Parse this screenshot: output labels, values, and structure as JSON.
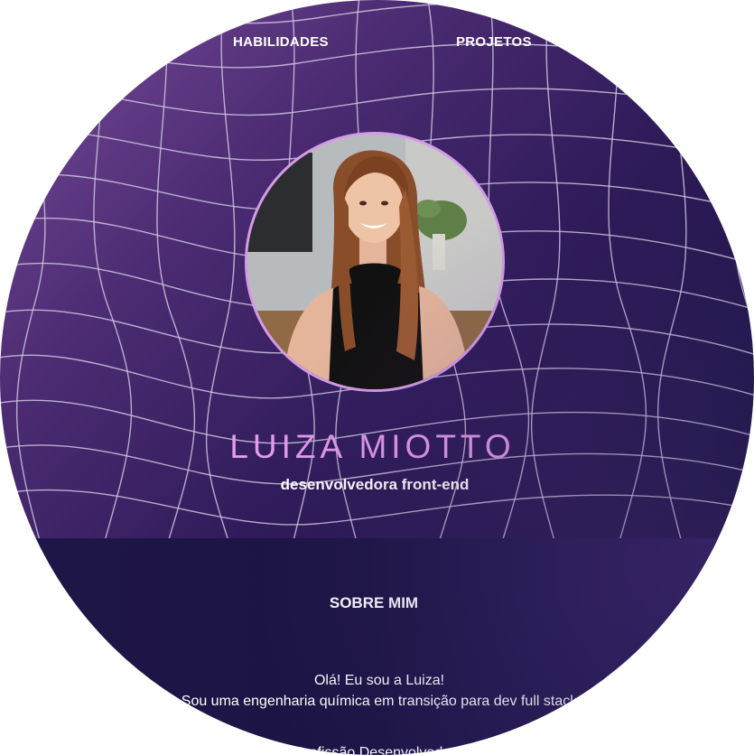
{
  "nav": {
    "skills_label": "HABILIDADES",
    "projects_label": "PROJETOS"
  },
  "hero": {
    "name": "LUIZA MIOTTO",
    "role": "desenvolvedora front-end",
    "avatar_alt": "Foto de Luiza Miotto"
  },
  "about": {
    "title": "SOBRE MIM",
    "line1": "Olá! Eu sou a Luiza!",
    "line2": "Sou uma engenharia química em transição para dev full stack",
    "line3": "Profissão Desenvolvedora"
  },
  "colors": {
    "accent": "#e29be8",
    "avatar_border": "#d59ae6",
    "background_dark": "#1c1446",
    "background_purple": "#7a4c9a",
    "text": "#ffffff"
  }
}
